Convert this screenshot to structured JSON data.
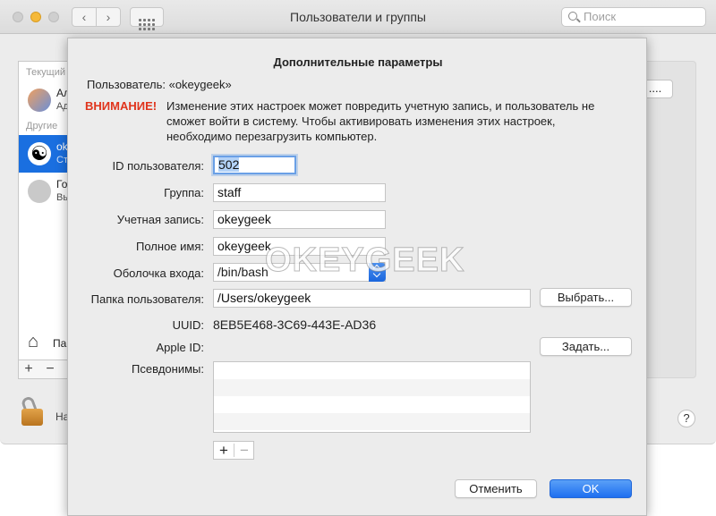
{
  "window": {
    "title": "Пользователи и группы",
    "search_placeholder": "Поиск",
    "nav_back": "‹",
    "nav_forward": "›"
  },
  "sidebar": {
    "current_section": "Текущий",
    "others_section": "Другие",
    "users": [
      {
        "name": "Ал",
        "sub": "Ад"
      },
      {
        "name": "ok",
        "sub": "Ст"
      },
      {
        "name": "Го",
        "sub": "Вы"
      }
    ],
    "home_label": "Па",
    "plus": "+",
    "minus": "−"
  },
  "right_panel": {
    "button_label": "...."
  },
  "bottom": {
    "lock_label": "На",
    "help": "?"
  },
  "sheet": {
    "title": "Дополнительные параметры",
    "user_line": "Пользователь:  «okeygeek»",
    "warning_title": "ВНИМАНИЕ!",
    "warning_text": "Изменение этих настроек может повредить учетную запись, и пользователь не сможет войти в систему. Чтобы активировать изменения этих настроек, необходимо перезагрузить компьютер.",
    "fields": {
      "user_id_label": "ID пользователя:",
      "user_id_value": "502",
      "group_label": "Группа:",
      "group_value": "staff",
      "account_label": "Учетная запись:",
      "account_value": "okeygeek",
      "fullname_label": "Полное имя:",
      "fullname_value": "okeygeek",
      "shell_label": "Оболочка входа:",
      "shell_value": "/bin/bash",
      "home_label": "Папка пользователя:",
      "home_value": "/Users/okeygeek",
      "uuid_label": "UUID:",
      "uuid_value": "8EB5E468-3C69-443E-AD36",
      "appleid_label": "Apple ID:",
      "aliases_label": "Псевдонимы:"
    },
    "buttons": {
      "choose": "Выбрать...",
      "set": "Задать...",
      "cancel": "Отменить",
      "ok": "OK",
      "alias_add": "+",
      "alias_remove": "−"
    }
  },
  "watermark": "OKEYGEEK",
  "colors": {
    "accent": "#1e6ff0",
    "warning": "#e0341c",
    "selection": "#1a6fe0"
  }
}
